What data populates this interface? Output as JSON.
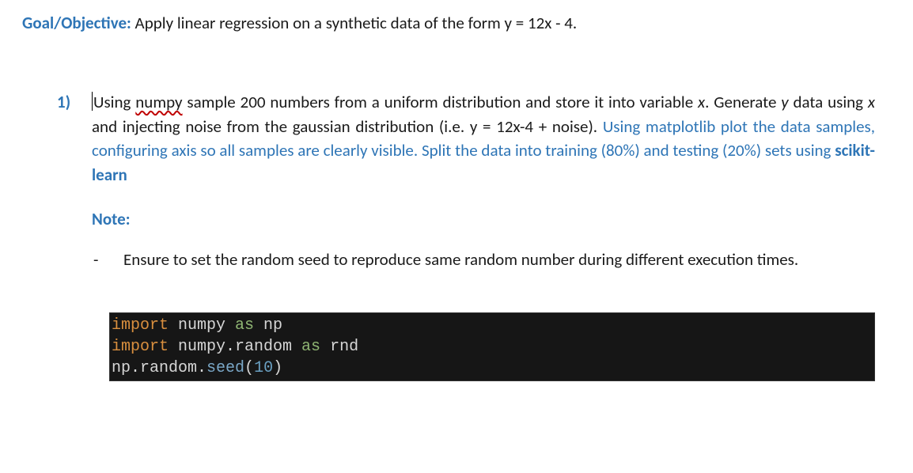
{
  "goal": {
    "label": "Goal/Objective:",
    "text": " Apply linear regression on a synthetic data of the form y = 12x - 4."
  },
  "question": {
    "number": "1)",
    "using_word": "Using ",
    "numpy_word": "numpy",
    "part1_after_numpy": " sample 200 numbers from a uniform distribution and store it into variable ",
    "var_x": "x",
    "part1_after_x": ".  Generate ",
    "var_y": "y",
    "part1_after_y": " data using ",
    "var_x2": "x",
    "part1_after_x2": " and injecting noise from the gaussian distribution (i.e. y = 12x-4 + noise). ",
    "blue1": "Using matplotlib plot the data samples, configuring axis so all samples are clearly visible.",
    "space1": " ",
    "blue2_pre": "Split the data into training (80%) and testing (20%) sets using ",
    "blue2_bold": "scikit-learn"
  },
  "note_label": "Note:",
  "bullet": {
    "dash": "-",
    "text": "Ensure to set the random seed to reproduce same random number during different execution times."
  },
  "code": {
    "l1_import": "import",
    "l1_rest1": " numpy ",
    "l1_as": "as",
    "l1_rest2": " np",
    "l2_import": "import",
    "l2_rest1": " numpy.random ",
    "l2_as": "as",
    "l2_rest2": " rnd",
    "l3_pre": "np.random.",
    "l3_fn": "seed",
    "l3_open": "(",
    "l3_num": "10",
    "l3_close": ")"
  }
}
